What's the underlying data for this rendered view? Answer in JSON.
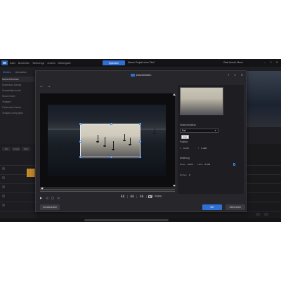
{
  "app": {
    "menu": [
      "Datei",
      "Bearbeiten",
      "Werkzeuge",
      "Ansicht",
      "Wiedergabe"
    ],
    "project_button": "Speichern",
    "project_title": "Neues Projekt ohne Titel*",
    "account": "Gast Anmel. Menu",
    "window_controls": [
      "–",
      "□",
      "✕"
    ]
  },
  "left_panel": {
    "tabs": [
      "Medien",
      "Animation"
    ],
    "items": [
      "Medienbibliothek",
      "Kostenlose Spezial.",
      "Soundeffekt-Archiv",
      "Stock-Ordner",
      "Vorlagen",
      "Farbmuster-Kasten",
      "Vorlagen-Leerprojekt"
    ]
  },
  "timeline": {
    "tools": [
      "Alle",
      "Gruppe",
      "Nach"
    ]
  },
  "dialog": {
    "title": "Zuschneiden",
    "controls": [
      "?",
      "□",
      "✕"
    ],
    "undo": "↶",
    "redo": "↷",
    "timecode": "00 ; 00 ; 00 ; 00",
    "aspect_label": "Angep.",
    "reset_button": "Zurücksetzen",
    "ok_button": "OK",
    "cancel_button": "Abbrechen",
    "side": {
      "aspect_section": "Seitenverhältnis",
      "aspect_value": "Frei",
      "tooltip": "Frei",
      "position_section": "Position",
      "pos_x_label": "X",
      "pos_x_value": "0.135",
      "pos_y_label": "Y",
      "pos_y_value": "0.348",
      "size_section": "Änderung",
      "width_label": "Breite",
      "width_value": "0.578",
      "height_label": "Höhe",
      "height_value": "0.578",
      "rotate_label": "Drehen",
      "rotate_value": "0"
    },
    "playback": [
      "▶",
      "◁",
      "▢",
      "▷"
    ]
  },
  "colors": {
    "accent": "#2f6fd6",
    "background": "#1b1b1e",
    "dialog": "#26262b"
  }
}
